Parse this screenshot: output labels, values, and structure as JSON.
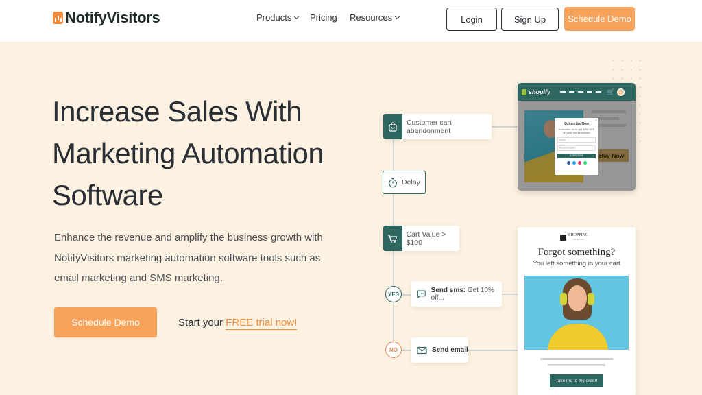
{
  "header": {
    "logo_text": "NotifyVisitors",
    "nav": {
      "products": "Products",
      "pricing": "Pricing",
      "resources": "Resources"
    },
    "login": "Login",
    "signup": "Sign Up",
    "schedule_demo": "Schedule Demo"
  },
  "hero": {
    "title_line1": "Increase Sales With",
    "title_line2": "Marketing Automation",
    "title_line3": "Software",
    "description": "Enhance the revenue and amplify the business growth with NotifyVisitors marketing automation software tools such as email marketing and SMS marketing.",
    "cta": "Schedule Demo",
    "trial_prefix": "Start your ",
    "trial_link": "FREE trial now!"
  },
  "flow": {
    "cart_abandonment": "Customer cart abandonment",
    "delay": "Delay",
    "cart_value": "Cart Value > $100",
    "yes": "YES",
    "no": "NO",
    "sms_bold": "Send sms:",
    "sms_text": " Get 10% off...",
    "email_bold": "Send email"
  },
  "shopify_mockup": {
    "brand": "shopify",
    "buy_now": "Buy Now",
    "popup_title": "Subscribe Now",
    "popup_sub": "Subscribe us to get 10% OFF on your first purchase!",
    "popup_name": "Name",
    "popup_phone": "Phone number",
    "popup_btn": "SUBSCRIBE",
    "social_colors": [
      "#3b5998",
      "#1da1f2",
      "#e1306c",
      "#25d366"
    ]
  },
  "email_mockup": {
    "logo_text": "SHOPPING",
    "logo_sub": "CENTRE",
    "title": "Forgot something?",
    "subtitle": "You left something in your cart",
    "button": "Take me to my order!"
  },
  "colors": {
    "accent": "#f7a25a",
    "teal": "#2e6760",
    "background": "#fdf1e1"
  }
}
